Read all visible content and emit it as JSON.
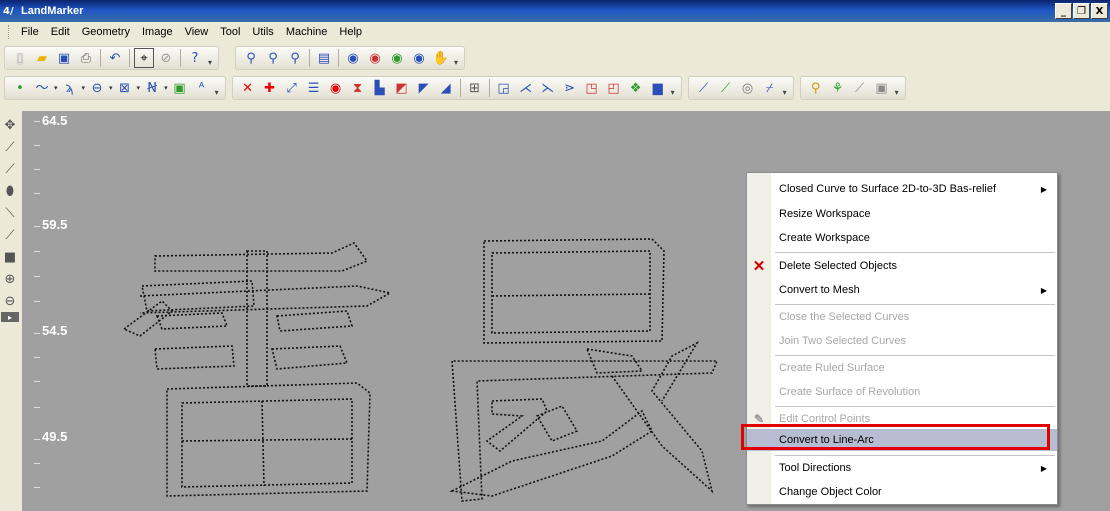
{
  "window": {
    "title": "LandMarker",
    "controls": [
      "_",
      "❐",
      "X"
    ]
  },
  "menubar": {
    "items": [
      "File",
      "Edit",
      "Geometry",
      "Image",
      "View",
      "Tool",
      "Utils",
      "Machine",
      "Help"
    ]
  },
  "ruler": {
    "labels": [
      "64.5",
      "59.5",
      "54.5",
      "49.5"
    ]
  },
  "context_menu": {
    "items": [
      {
        "label": "Closed Curve to Surface  2D-to-3D Bas-relief",
        "submenu": true,
        "disabled": false
      },
      {
        "label": "Resize Workspace",
        "submenu": false,
        "disabled": false
      },
      {
        "label": "Create Workspace",
        "submenu": false,
        "disabled": false
      },
      {
        "label": "Delete Selected Objects",
        "submenu": false,
        "disabled": false,
        "icon": "red-x-icon"
      },
      {
        "label": "Convert to Mesh",
        "submenu": true,
        "disabled": false
      },
      {
        "label": "Close the Selected Curves",
        "submenu": false,
        "disabled": true
      },
      {
        "label": "Join Two Selected Curves",
        "submenu": false,
        "disabled": true
      },
      {
        "label": "Create Ruled Surface",
        "submenu": false,
        "disabled": true
      },
      {
        "label": "Create Surface of Revolution",
        "submenu": false,
        "disabled": true
      },
      {
        "label": "Edit Control Points",
        "submenu": false,
        "disabled": true,
        "icon": "edit-points-icon"
      },
      {
        "label": "Convert to Line-Arc",
        "submenu": false,
        "disabled": false,
        "highlighted": true
      },
      {
        "label": "Tool Directions",
        "submenu": true,
        "disabled": false
      },
      {
        "label": "Change Object Color",
        "submenu": false,
        "disabled": false
      }
    ]
  },
  "colors": {
    "workspace_bg": "#a0a0a0",
    "highlight_border": "#e20000",
    "title_bar": "#0a246a"
  }
}
